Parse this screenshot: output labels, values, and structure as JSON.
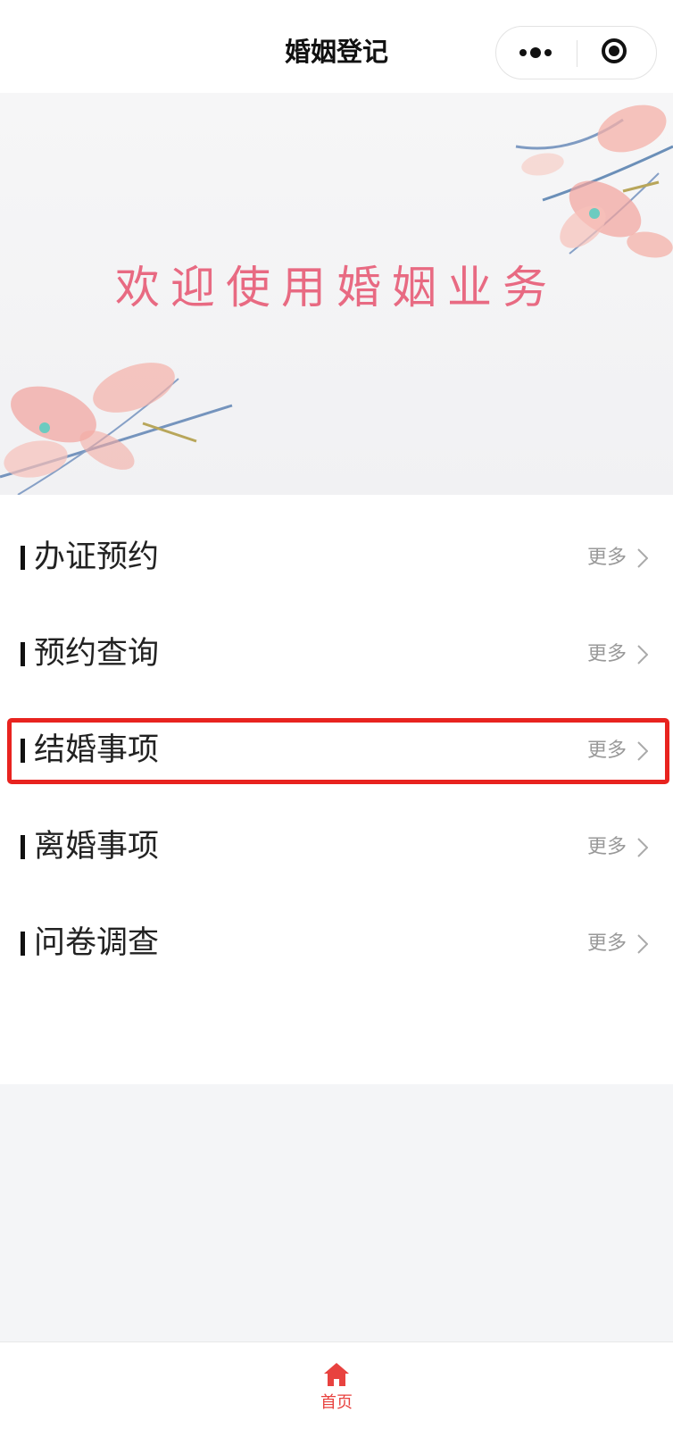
{
  "navbar": {
    "title": "婚姻登记",
    "more_icon": "more-dots-icon",
    "close_icon": "capsule-close-icon"
  },
  "banner": {
    "text": "欢迎使用婚姻业务",
    "text_color": "#e86a82"
  },
  "list": {
    "more_label": "更多",
    "items": [
      {
        "label": "办证预约"
      },
      {
        "label": "预约查询"
      },
      {
        "label": "结婚事项",
        "highlighted": true
      },
      {
        "label": "离婚事项"
      },
      {
        "label": "问卷调查"
      }
    ]
  },
  "tabbar": {
    "items": [
      {
        "label": "首页",
        "icon": "home-icon",
        "active": true
      }
    ]
  },
  "colors": {
    "accent": "#e8423f",
    "highlight_border": "#e8231f"
  }
}
